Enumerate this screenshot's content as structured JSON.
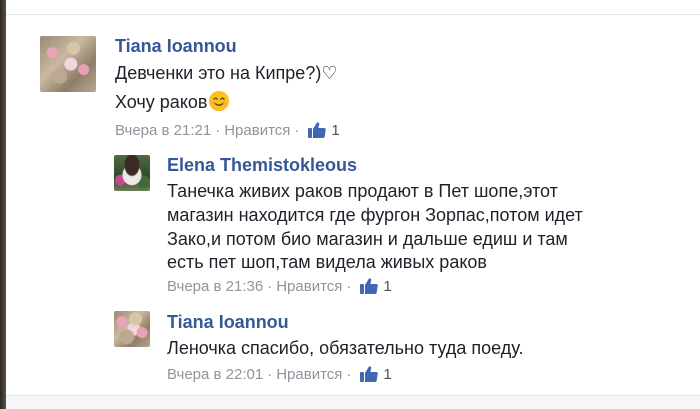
{
  "comments": [
    {
      "author": "Tiana Ioannou",
      "lines": [
        "Девченки это на Кипре?)♡",
        "Хочу раков"
      ],
      "time": "Вчера в 21:21",
      "like_label": "Нравится",
      "likes": "1",
      "avatar": "flowers-photo"
    },
    {
      "author": "Elena Themistokleous",
      "lines": [
        "Танечка живих раков продают в Пет шопе,этот",
        "магазин находится где фургон Зорпас,потом идет",
        "Зако,и потом био магазин и дальше едиш и там",
        "есть пет шоп,там видела живых раков"
      ],
      "time": "Вчера в 21:36",
      "like_label": "Нравится",
      "likes": "1",
      "avatar": "person-photo"
    },
    {
      "author": "Tiana Ioannou",
      "lines": [
        "Леночка спасибо, обязательно туда поеду."
      ],
      "time": "Вчера в 22:01",
      "like_label": "Нравится",
      "likes": "1",
      "avatar": "flowers-photo"
    }
  ],
  "separator": "·",
  "colors": {
    "name": "#365899",
    "text": "#1d2129",
    "meta": "#90949c",
    "like_icon": "#4267b2"
  },
  "icons": {
    "like": "thumbs-up-icon",
    "emoji": "smiling-face-emoji"
  }
}
